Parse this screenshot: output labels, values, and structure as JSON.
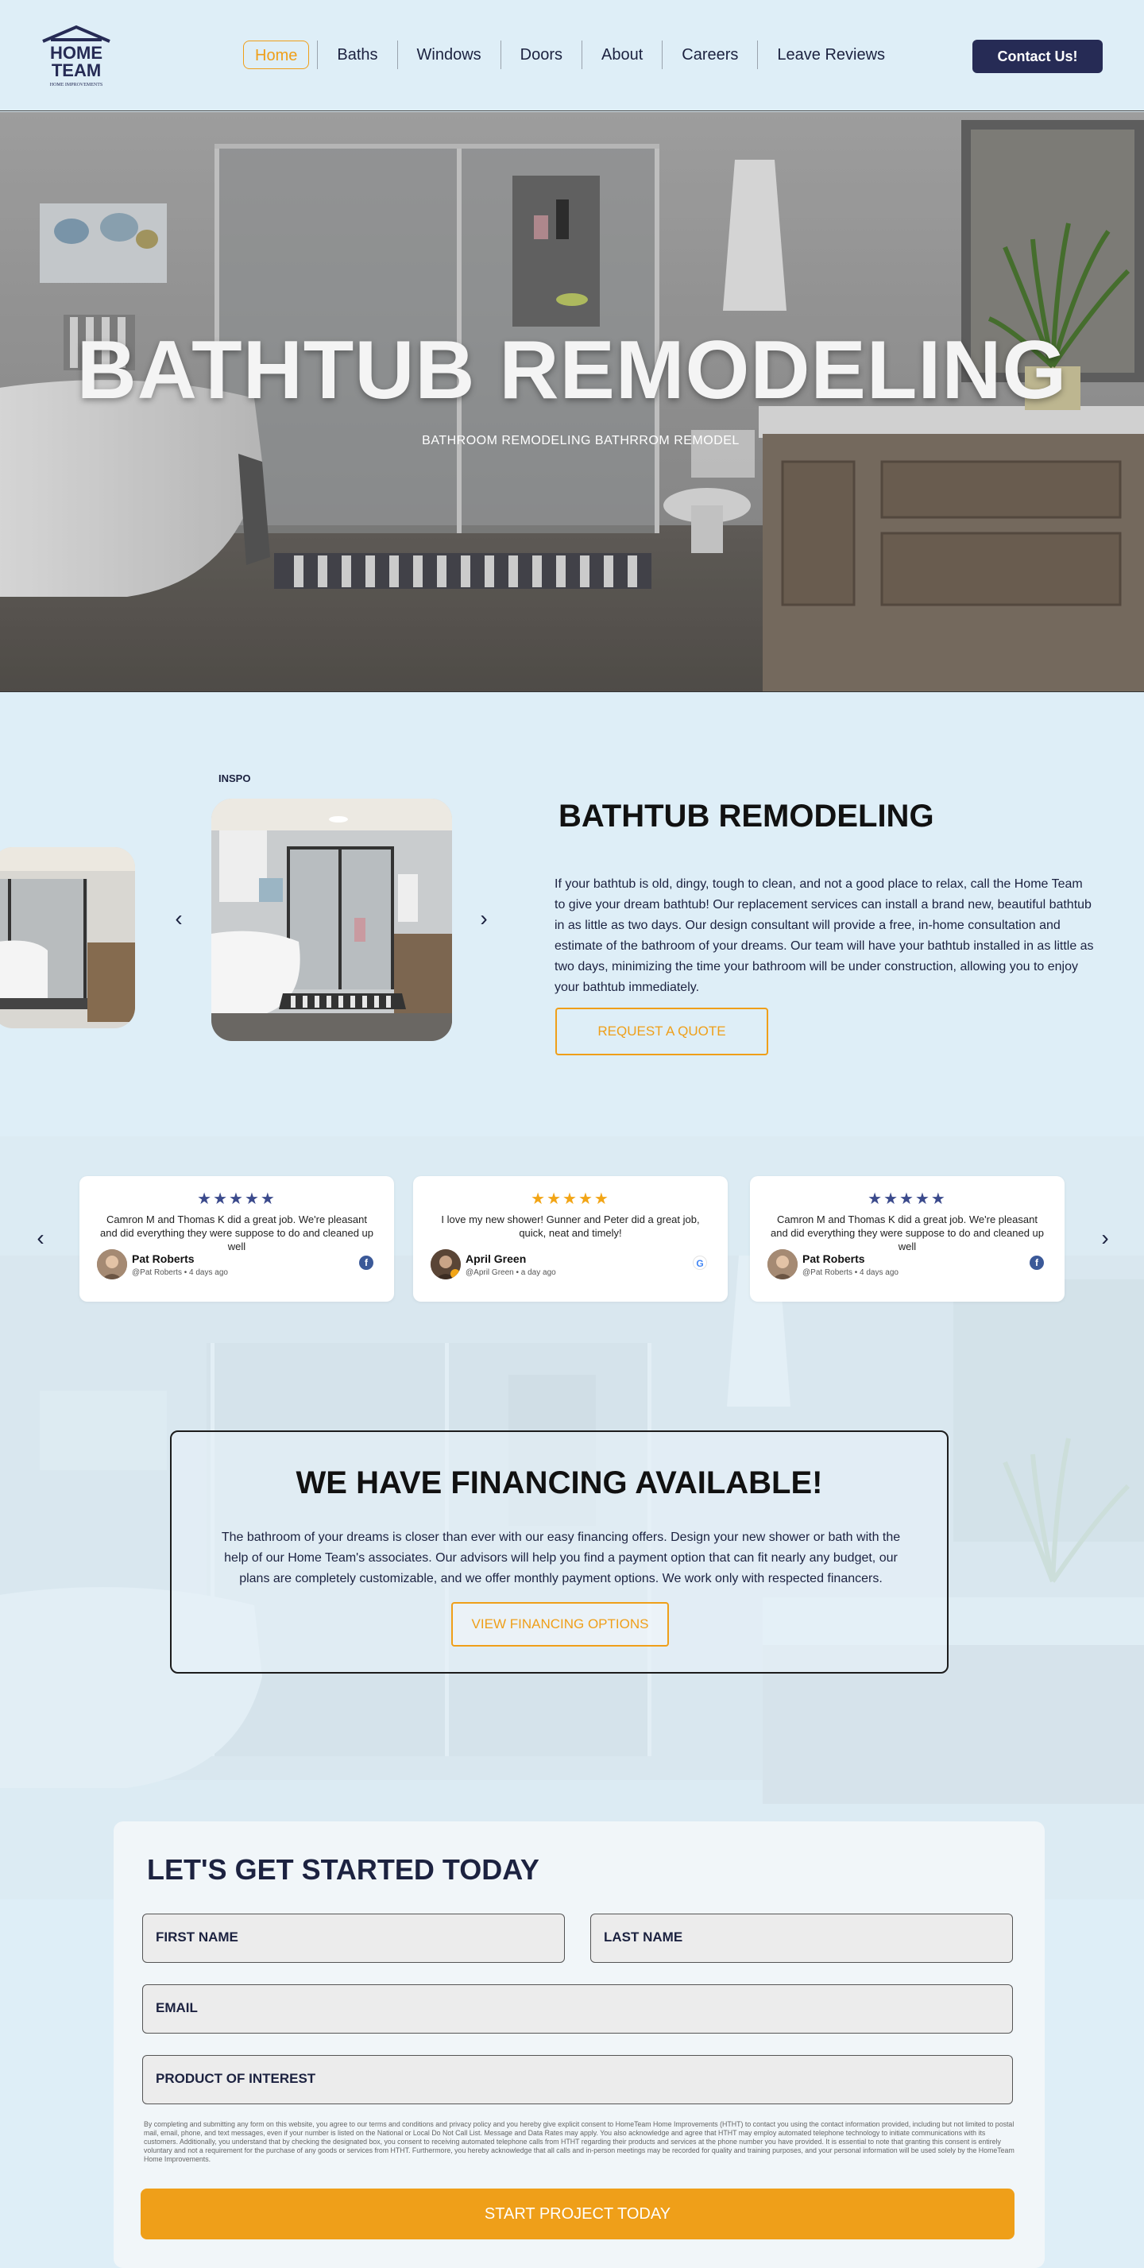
{
  "header": {
    "logo": {
      "line1": "HOME",
      "line2": "TEAM",
      "tagline": "HOME IMPROVEMENTS"
    },
    "nav": [
      "Home",
      "Baths",
      "Windows",
      "Doors",
      "About",
      "Careers",
      "Leave Reviews"
    ],
    "active_nav": "Home",
    "contact_label": "Contact Us!"
  },
  "hero": {
    "title": "BATHTUB REMODELING",
    "subtitle": "BATHROOM REMODELING BATHRROM REMODEL"
  },
  "intro": {
    "gallery_label": "INSPO",
    "title": "BATHTUB REMODELING",
    "body": "If your bathtub is old, dingy, tough to clean, and not a good place to relax, call the Home Team to give your dream bathtub! Our replacement services can install a brand new, beautiful bathtub in as little as two days. Our design consultant will provide a free, in-home consultation and estimate of the bathroom of your dreams. Our team will have your bathtub installed in as little as two days, minimizing the time your bathroom will be under construction, allowing you to enjoy your bathtub immediately.",
    "quote_button": "REQUEST A QUOTE"
  },
  "reviews": [
    {
      "stars": "★★★★★",
      "star_color": "#3b4a8c",
      "text": "Camron M and Thomas K did a great job. We're pleasant and did everything they were suppose to do and cleaned up well",
      "name": "Pat Roberts",
      "meta": "@Pat Roberts • 4 days ago",
      "source_icon": "facebook-icon",
      "source_glyph": "f"
    },
    {
      "stars": "★★★★★",
      "star_color": "#f2a516",
      "text": "I love my new shower! Gunner and Peter did a great job, quick, neat and timely!",
      "name": "April Green",
      "meta": "@April Green • a day ago",
      "source_icon": "google-icon",
      "source_glyph": "G"
    },
    {
      "stars": "★★★★★",
      "star_color": "#3b4a8c",
      "text": "Camron M and Thomas K did a great job. We're pleasant and did everything they were suppose to do and cleaned up well",
      "name": "Pat Roberts",
      "meta": "@Pat Roberts • 4 days ago",
      "source_icon": "facebook-icon",
      "source_glyph": "f"
    }
  ],
  "financing": {
    "title": "WE HAVE FINANCING AVAILABLE!",
    "body": "The bathroom of your dreams is closer than ever with our easy financing offers.  Design your new shower or bath with the help of our Home Team's associates. Our advisors will help you find a payment option that can fit nearly any budget, our plans are completely customizable, and we offer monthly payment options. We work only with respected financers.",
    "button": "VIEW FINANCING OPTIONS"
  },
  "form": {
    "title": "LET'S GET STARTED TODAY",
    "first_name": "FIRST NAME",
    "last_name": "LAST NAME",
    "email": "EMAIL",
    "product": "PRODUCT OF INTEREST",
    "disclaimer": "By completing and submitting any form on this website, you agree to our terms and conditions and privacy policy and you hereby give explicit consent to HomeTeam Home Improvements (HTHT) to contact you using the contact information provided, including but not limited to postal mail, email, phone, and text messages, even if your number is listed on the National or Local Do Not Call List. Message and Data Rates may apply. You also acknowledge and agree that HTHT may employ automated telephone technology to initiate communications with its customers. Additionally, you understand that by checking the designated box, you consent to receiving automated telephone calls from HTHT regarding their products and services at the phone number you have provided. It is essential to note that granting this consent is entirely voluntary and not a requirement for the purchase of any goods or services from HTHT. Furthermore, you hereby acknowledge that all calls and in-person meetings may be recorded for quality and training purposes, and your personal information will be used solely by the HomeTeam Home Improvements.",
    "submit": "START PROJECT TODAY"
  },
  "colors": {
    "accent": "#ef9f19",
    "navy": "#262b55",
    "background": "#deeef7"
  }
}
